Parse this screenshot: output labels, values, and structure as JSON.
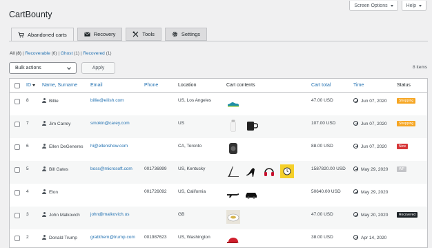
{
  "top_actions": {
    "screen_options": "Screen Options",
    "help": "Help"
  },
  "page_title": "CartBounty",
  "tabs": [
    {
      "label": "Abandoned carts",
      "icon": "cart-icon",
      "active": true
    },
    {
      "label": "Recovery",
      "icon": "envelope-icon",
      "active": false
    },
    {
      "label": "Tools",
      "icon": "tools-icon",
      "active": false
    },
    {
      "label": "Settings",
      "icon": "gear-icon",
      "active": false
    }
  ],
  "filters": {
    "all": "All",
    "all_count": "(8)",
    "recoverable": "Recoverable",
    "recoverable_count": "(6)",
    "ghost": "Ghost",
    "ghost_count": "(1)",
    "recovered": "Recovered",
    "recovered_count": "(1)",
    "sep": "|"
  },
  "bulk": {
    "selected": "Bulk actions",
    "apply": "Apply"
  },
  "items_count": "8 items",
  "columns": {
    "id": "ID",
    "name": "Name, Surname",
    "email": "Email",
    "phone": "Phone",
    "location": "Location",
    "cart": "Cart contents",
    "total": "Cart total",
    "time": "Time",
    "status": "Status"
  },
  "rows": [
    {
      "id": "8",
      "name": "Billie",
      "email": "billie@eilish.com",
      "phone": "",
      "location": "US, Los Angeles",
      "products": [
        "sneaker"
      ],
      "total": "47.00 USD",
      "time": "Jun 07, 2020",
      "status": "Shopping",
      "status_type": "shopping"
    },
    {
      "id": "7",
      "name": "Jim Carrey",
      "email": "smokin@carey.com",
      "phone": "",
      "location": "US",
      "products": [
        "bottle",
        "mug"
      ],
      "total": "107.00 USD",
      "time": "Jun 07, 2020",
      "status": "Shopping",
      "status_type": "shopping"
    },
    {
      "id": "6",
      "name": "Ellen DeGeneres",
      "email": "hi@ellenshow.com",
      "phone": "",
      "location": "CA, Toronto",
      "products": [
        "speaker"
      ],
      "total": "88.00 USD",
      "time": "Jun 07, 2020",
      "status": "New",
      "status_type": "new"
    },
    {
      "id": "5",
      "name": "Bill Gates",
      "email": "boss@microsoft.com",
      "phone": "001736999",
      "location": "US, Kentucky",
      "products": [
        "laptop",
        "heels",
        "headphones",
        "watch"
      ],
      "total": "1587820.00 USD",
      "time": "May 29, 2020",
      "status": "WP",
      "status_type": "wp"
    },
    {
      "id": "4",
      "name": "Elon",
      "email": "",
      "phone": "001726092",
      "location": "US, California",
      "products": [
        "rifle",
        "car"
      ],
      "total": "50640.00 USD",
      "time": "May 29, 2020",
      "status": "",
      "status_type": ""
    },
    {
      "id": "3",
      "name": "John Malkovich",
      "email": "john@malkovich.us",
      "phone": "",
      "location": "GB",
      "products": [
        "plate"
      ],
      "total": "47.00 USD",
      "time": "May 20, 2020",
      "status": "Recovered",
      "status_type": "recovered"
    },
    {
      "id": "2",
      "name": "Donald Trump",
      "email": "grabthem@trump.com",
      "phone": "001987623",
      "location": "US, Washington",
      "products": [
        "cap"
      ],
      "total": "38.00 USD",
      "time": "Apr 14, 2020",
      "status": "",
      "status_type": ""
    }
  ]
}
